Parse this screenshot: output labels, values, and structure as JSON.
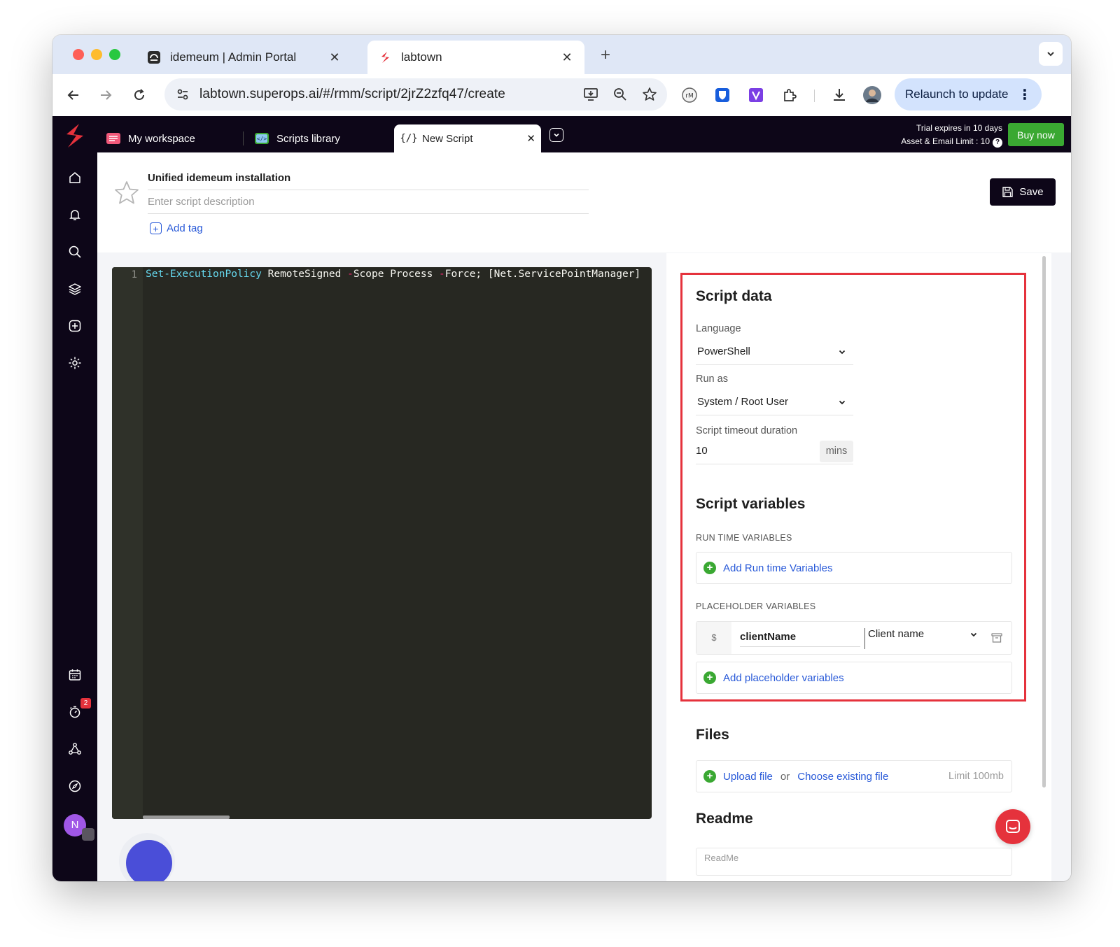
{
  "browser": {
    "tabs": [
      {
        "label": "idemeum | Admin Portal",
        "active": false
      },
      {
        "label": "labtown",
        "active": true
      }
    ],
    "url": "labtown.superops.ai/#/rmm/script/2jrZ2zfq47/create",
    "relaunch_label": "Relaunch to update"
  },
  "app": {
    "tabs": [
      {
        "label": "My workspace"
      },
      {
        "label": "Scripts library"
      },
      {
        "label": "New Script"
      }
    ],
    "new_script_icon": "{/}",
    "trial": {
      "line1": "Trial expires in 10 days",
      "line2": "Asset & Email Limit : 10",
      "help": "?"
    },
    "buy_now": "Buy now",
    "sidebar_badge": "2",
    "avatar_initial": "N"
  },
  "header": {
    "script_name": "Unified idemeum installation",
    "description_placeholder": "Enter script description",
    "add_tag": "Add tag",
    "save": "Save"
  },
  "editor": {
    "line_number": "1",
    "code": {
      "cmd": "Set-ExecutionPolicy",
      "arg1": " RemoteSigned ",
      "flag1": "-",
      "arg2": "Scope Process ",
      "flag2": "-",
      "arg3": "Force; [Net.ServicePointManager]"
    }
  },
  "script_data": {
    "title": "Script data",
    "language_label": "Language",
    "language_value": "PowerShell",
    "run_as_label": "Run as",
    "run_as_value": "System / Root User",
    "timeout_label": "Script timeout duration",
    "timeout_value": "10",
    "timeout_unit": "mins"
  },
  "script_variables": {
    "title": "Script variables",
    "runtime_header": "RUN TIME VARIABLES",
    "add_runtime": "Add Run time Variables",
    "placeholder_header": "PLACEHOLDER VARIABLES",
    "placeholder": {
      "prefix": "$",
      "name": "clientName",
      "type": "Client name"
    },
    "add_placeholder": "Add placeholder variables"
  },
  "files": {
    "title": "Files",
    "upload": "Upload file",
    "or": "or",
    "choose": "Choose existing file",
    "limit": "Limit 100mb"
  },
  "readme": {
    "title": "Readme",
    "placeholder": "ReadMe"
  },
  "colors": {
    "highlight_box": "#e5323c",
    "brand_dark": "#0d0618",
    "link_blue": "#2859d8",
    "add_green": "#3aa832"
  }
}
